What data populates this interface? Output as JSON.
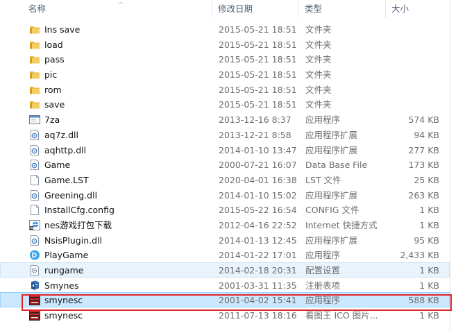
{
  "columns": {
    "name": "名称",
    "date": "修改日期",
    "type": "类型",
    "size": "大小"
  },
  "files": [
    {
      "name": "Ins save",
      "date": "2015-05-21 18:51",
      "type": "文件夹",
      "size": "",
      "icon": "folder-icon"
    },
    {
      "name": "load",
      "date": "2015-05-21 18:51",
      "type": "文件夹",
      "size": "",
      "icon": "folder-icon"
    },
    {
      "name": "pass",
      "date": "2015-05-21 18:51",
      "type": "文件夹",
      "size": "",
      "icon": "folder-icon"
    },
    {
      "name": "pic",
      "date": "2015-05-21 18:51",
      "type": "文件夹",
      "size": "",
      "icon": "folder-icon"
    },
    {
      "name": "rom",
      "date": "2015-05-21 18:51",
      "type": "文件夹",
      "size": "",
      "icon": "folder-icon"
    },
    {
      "name": "save",
      "date": "2015-05-21 18:51",
      "type": "文件夹",
      "size": "",
      "icon": "folder-icon"
    },
    {
      "name": "7za",
      "date": "2013-12-16 8:37",
      "type": "应用程序",
      "size": "574 KB",
      "icon": "app-window-icon"
    },
    {
      "name": "aq7z.dll",
      "date": "2013-12-21 8:58",
      "type": "应用程序扩展",
      "size": "94 KB",
      "icon": "dll-file-icon"
    },
    {
      "name": "aqhttp.dll",
      "date": "2014-01-10 13:47",
      "type": "应用程序扩展",
      "size": "277 KB",
      "icon": "dll-file-icon"
    },
    {
      "name": "Game",
      "date": "2000-07-21 16:07",
      "type": "Data Base File",
      "size": "173 KB",
      "icon": "dll-file-icon"
    },
    {
      "name": "Game.LST",
      "date": "2020-04-01 16:38",
      "type": "LST 文件",
      "size": "25 KB",
      "icon": "blank-file-icon"
    },
    {
      "name": "Greening.dll",
      "date": "2014-01-10 15:02",
      "type": "应用程序扩展",
      "size": "263 KB",
      "icon": "dll-file-icon"
    },
    {
      "name": "InstallCfg.config",
      "date": "2015-05-22 16:54",
      "type": "CONFIG 文件",
      "size": "1 KB",
      "icon": "blank-file-icon"
    },
    {
      "name": "nes游戏打包下载",
      "date": "2012-04-16 22:52",
      "type": "Internet 快捷方式",
      "size": "1 KB",
      "icon": "internet-shortcut-icon"
    },
    {
      "name": "NsisPlugin.dll",
      "date": "2014-01-13 12:45",
      "type": "应用程序扩展",
      "size": "95 KB",
      "icon": "dll-file-icon"
    },
    {
      "name": "PlayGame",
      "date": "2014-01-22 17:01",
      "type": "应用程序",
      "size": "2,433 KB",
      "icon": "playgame-icon"
    },
    {
      "name": "rungame",
      "date": "2014-02-18 20:31",
      "type": "配置设置",
      "size": "1 KB",
      "icon": "config-settings-icon"
    },
    {
      "name": "Smynes",
      "date": "2001-03-31 11:35",
      "type": "注册表项",
      "size": "1 KB",
      "icon": "registry-icon"
    },
    {
      "name": "smynesc",
      "date": "2001-04-02 15:41",
      "type": "应用程序",
      "size": "588 KB",
      "icon": "smynes-app-icon"
    },
    {
      "name": "smynesc",
      "date": "2011-07-13 18:16",
      "type": "看图王 ICO 图片...",
      "size": "1 KB",
      "icon": "smynes-app-icon"
    }
  ],
  "colors": {
    "highlight": "#e0262b",
    "selected_bg": "#cce8ff",
    "hover_bg": "#e9f3fc",
    "folder": "#e8b43c"
  }
}
